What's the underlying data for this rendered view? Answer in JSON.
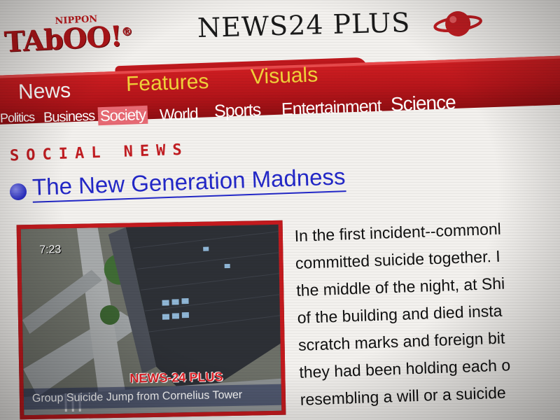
{
  "logo": {
    "small": "NIPPON",
    "main": "TAbOO!",
    "registered": "®"
  },
  "site_title": "NEWS24 PLUS",
  "nav": {
    "tabs": [
      {
        "label": "News",
        "active": true
      },
      {
        "label": "Features",
        "active": false
      },
      {
        "label": "Visuals",
        "active": false
      }
    ],
    "sub_items": [
      {
        "label": "Politics",
        "active": false
      },
      {
        "label": "Business",
        "active": false
      },
      {
        "label": "Society",
        "active": true
      },
      {
        "label": "World",
        "active": false
      },
      {
        "label": "Sports",
        "active": false
      },
      {
        "label": "Entertainment",
        "active": false
      },
      {
        "label": "Science",
        "active": false
      }
    ]
  },
  "section": {
    "label": "SOCIAL NEWS"
  },
  "article": {
    "headline": "The New Generation Madness",
    "image": {
      "time": "7:23",
      "watermark": "NEWS-24 PLUS",
      "caption": "Group Suicide Jump from Cornelius Tower"
    },
    "lines": [
      "In the first incident--commonl",
      "committed suicide together. I",
      "the middle of the night, at Shi",
      "of the building and died insta",
      "scratch marks and foreign bit",
      "they had been holding each o",
      "resembling a will or a suicide"
    ]
  },
  "colors": {
    "brand_red": "#c21d22",
    "tab_yellow": "#f1d33a",
    "link_blue": "#2328c8",
    "active_sub_bg": "#e86a74"
  }
}
